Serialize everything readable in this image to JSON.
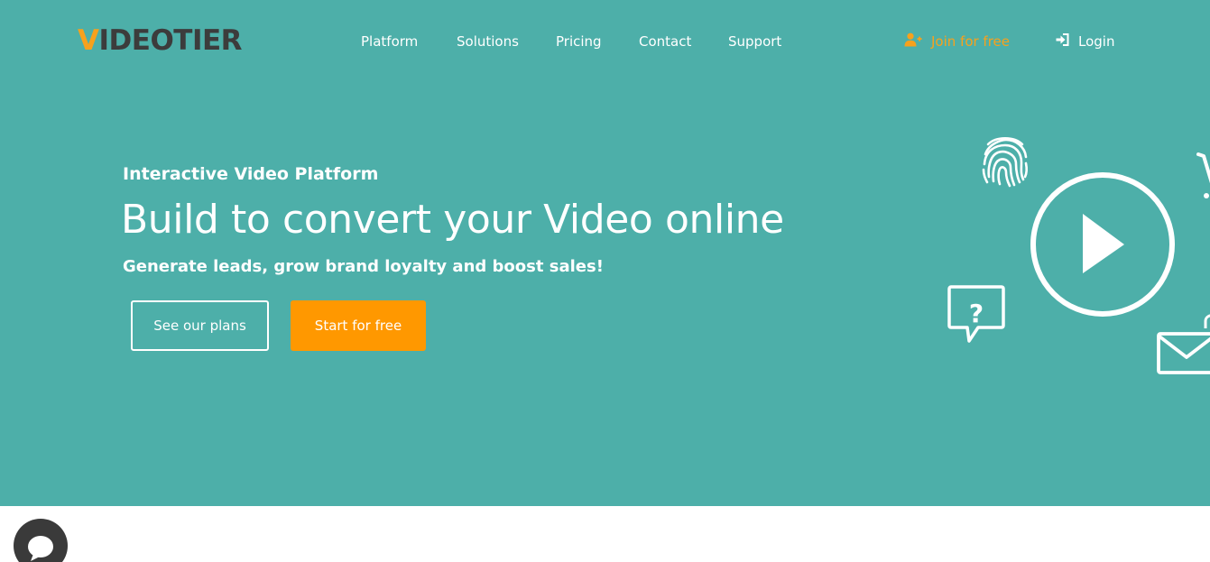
{
  "brand": {
    "logo_first_letter": "V",
    "logo_rest": "IDEOTIER",
    "accent_color": "#f7a11c",
    "hero_background": "#4dafa9",
    "cta_color": "#ff9800"
  },
  "nav": {
    "items": [
      {
        "label": "Platform"
      },
      {
        "label": "Solutions"
      },
      {
        "label": "Pricing"
      },
      {
        "label": "Contact"
      },
      {
        "label": "Support"
      }
    ],
    "join": {
      "label": "Join for free",
      "icon": "user-plus-icon"
    },
    "login": {
      "label": "Login",
      "icon": "sign-in-icon"
    }
  },
  "hero": {
    "eyebrow": "Interactive Video Platform",
    "headline": "Build to convert your Video online",
    "subline": "Generate leads, grow brand loyalty and boost sales!",
    "primary_button": "See our plans",
    "secondary_button": "Start for free"
  },
  "illustration": {
    "icons": [
      "fingerprint-icon",
      "play-circle-icon",
      "question-bubble-icon",
      "mail-icon",
      "cart-icon",
      "lock-icon"
    ]
  },
  "chat": {
    "icon": "chat-bubble-icon"
  }
}
